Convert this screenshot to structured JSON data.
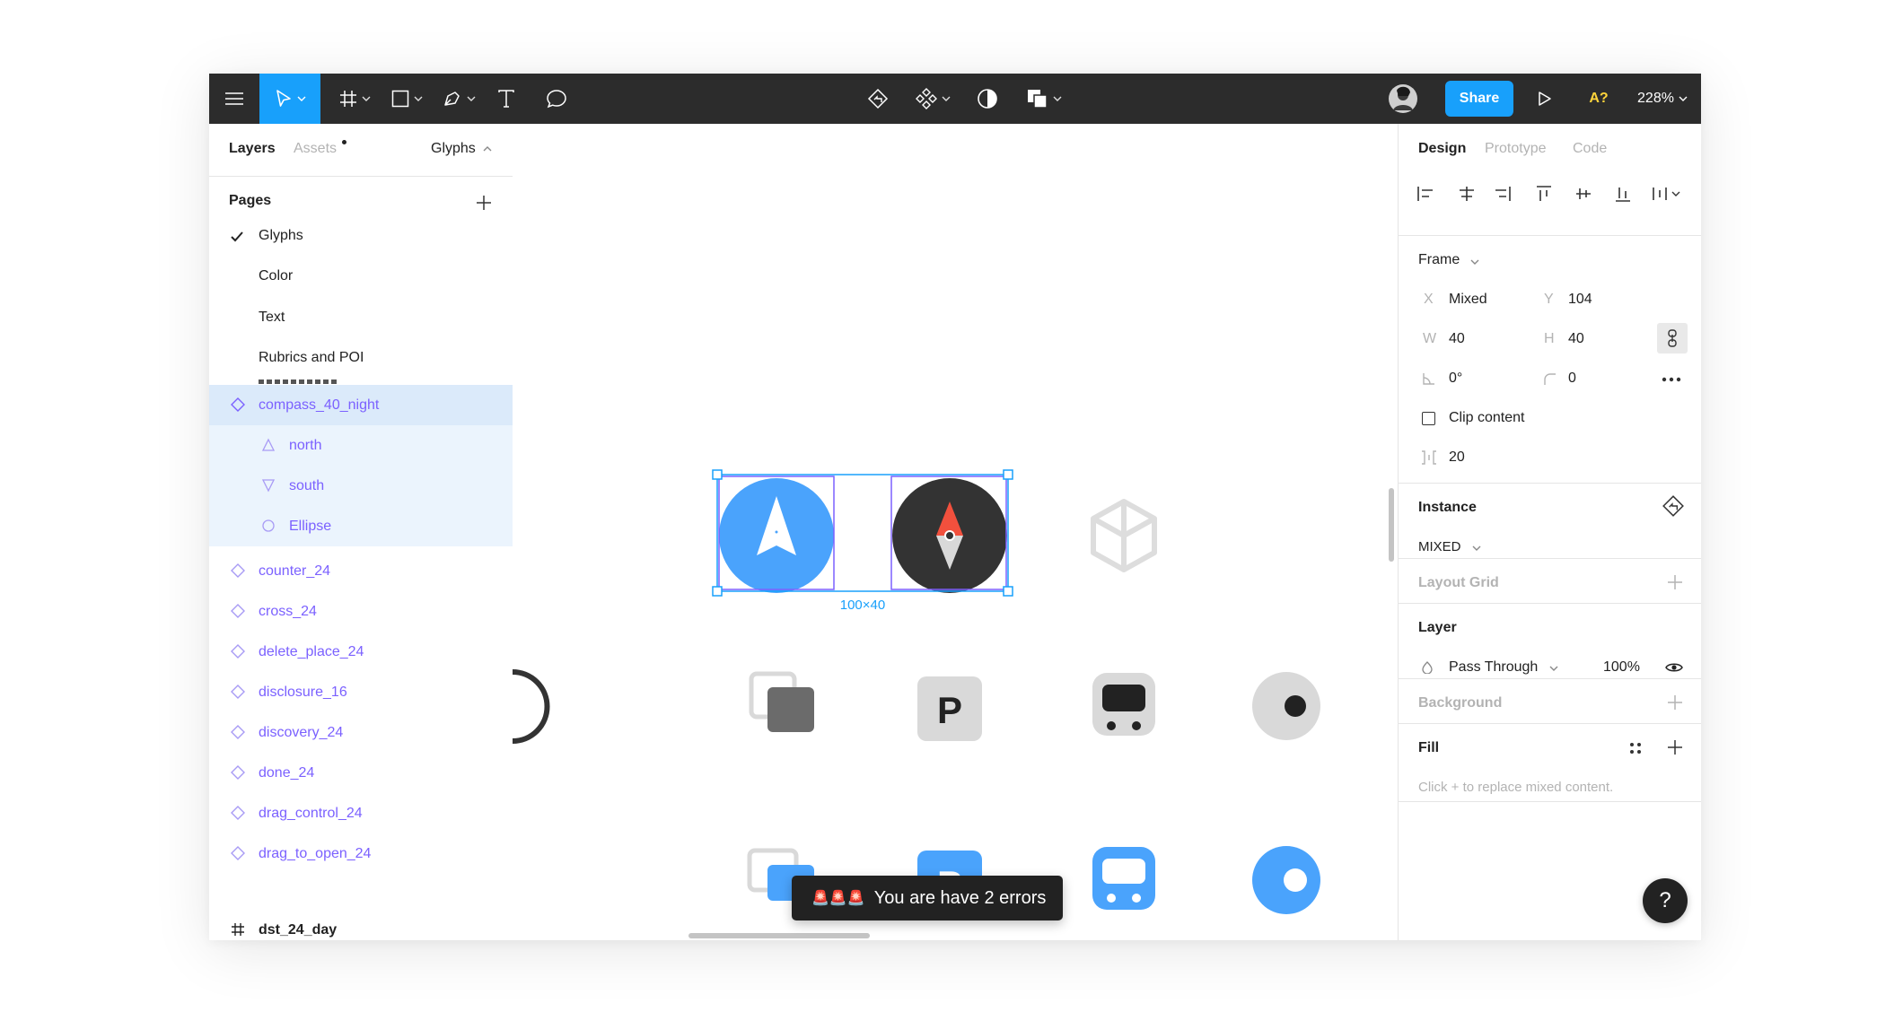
{
  "toolbar": {
    "share_label": "Share",
    "multiplayer_label": "A?",
    "zoom_label": "228%"
  },
  "left_panel": {
    "tabs": {
      "layers": "Layers",
      "assets": "Assets",
      "page_select": "Glyphs"
    },
    "pages_heading": "Pages",
    "pages": [
      "Glyphs",
      "Color",
      "Text",
      "Rubrics and POI"
    ],
    "layers": {
      "selected": "compass_40_night",
      "children": [
        "north",
        "south",
        "Ellipse"
      ],
      "components": [
        "counter_24",
        "cross_24",
        "delete_place_24",
        "disclosure_16",
        "discovery_24",
        "done_24",
        "drag_control_24",
        "drag_to_open_24"
      ],
      "frame": "dst_24_day"
    }
  },
  "canvas": {
    "selection_size": "100×40",
    "toast_text": "You are have 2 errors",
    "toast_icons": "🚨🚨🚨",
    "p_label": "P"
  },
  "right_panel": {
    "tabs": {
      "design": "Design",
      "prototype": "Prototype",
      "code": "Code"
    },
    "frame_label": "Frame",
    "x_label": "X",
    "x_value": "Mixed",
    "y_label": "Y",
    "y_value": "104",
    "w_label": "W",
    "w_value": "40",
    "h_label": "H",
    "h_value": "40",
    "rotation_value": "0°",
    "radius_value": "0",
    "clip_label": "Clip content",
    "spacing_value": "20",
    "instance_label": "Instance",
    "instance_value": "MIXED",
    "layout_grid_label": "Layout Grid",
    "layer_label": "Layer",
    "blend_mode": "Pass Through",
    "opacity": "100%",
    "background_label": "Background",
    "fill_label": "Fill",
    "fill_hint": "Click + to replace mixed content.",
    "help_label": "?"
  },
  "colors": {
    "accent": "#18a0fb",
    "component": "#7b61ff",
    "selection": "#dbeafa",
    "glyph_blue": "#4aa3fc"
  }
}
